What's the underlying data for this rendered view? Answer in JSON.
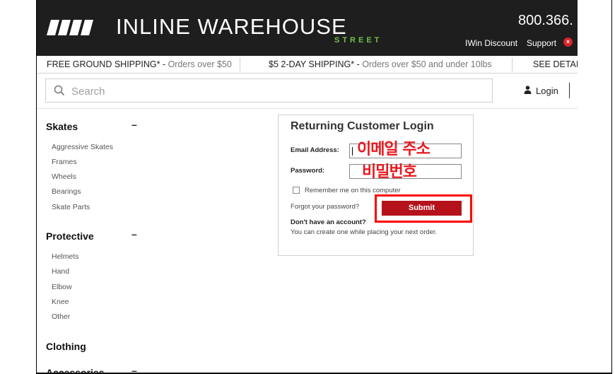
{
  "header": {
    "logo_text": "INLINE WAREHOUSE",
    "logo_sub": "STREET",
    "phone": "800.366.",
    "links": [
      "IWin Discount",
      "Support"
    ],
    "close_glyph": "×",
    "bg_color": "#1e1e1e",
    "accent_color": "#6fc04a"
  },
  "shipping": {
    "free": {
      "label": "FREE GROUND SHIPPING* -",
      "note": "Orders over $50"
    },
    "two_day": {
      "label": "$5 2-DAY SHIPPING* -",
      "note": "Orders over $50 and under 10lbs"
    },
    "see_details": "SEE DETAI"
  },
  "search": {
    "placeholder": "Search",
    "icon": "search-icon"
  },
  "account": {
    "login_label": "Login",
    "icon": "user-icon"
  },
  "sidebar": {
    "categories": [
      {
        "title": "Skates",
        "toggle": "–",
        "items": [
          "Aggressive Skates",
          "Frames",
          "Wheels",
          "Bearings",
          "Skate Parts"
        ]
      },
      {
        "title": "Protective",
        "toggle": "–",
        "items": [
          "Helmets",
          "Hand",
          "Elbow",
          "Knee",
          "Other"
        ]
      },
      {
        "title": "Clothing",
        "toggle": "",
        "items": []
      },
      {
        "title": "Accessories",
        "toggle": "–",
        "items": []
      }
    ]
  },
  "login_form": {
    "title": "Returning Customer Login",
    "email_label": "Email Address:",
    "email_value": "",
    "password_label": "Password:",
    "password_value": "",
    "remember_label": "Remember me on this computer",
    "remember_checked": false,
    "forgot_label": "Forgot your password?",
    "submit_label": "Submit",
    "no_account": "Don't have an account?",
    "create_note": "You can create one while placing your next order.",
    "submit_color": "#b5121b"
  },
  "annotations": {
    "email_note": "이메일 주소",
    "password_note": "비밀번호",
    "color": "#e8191f"
  }
}
